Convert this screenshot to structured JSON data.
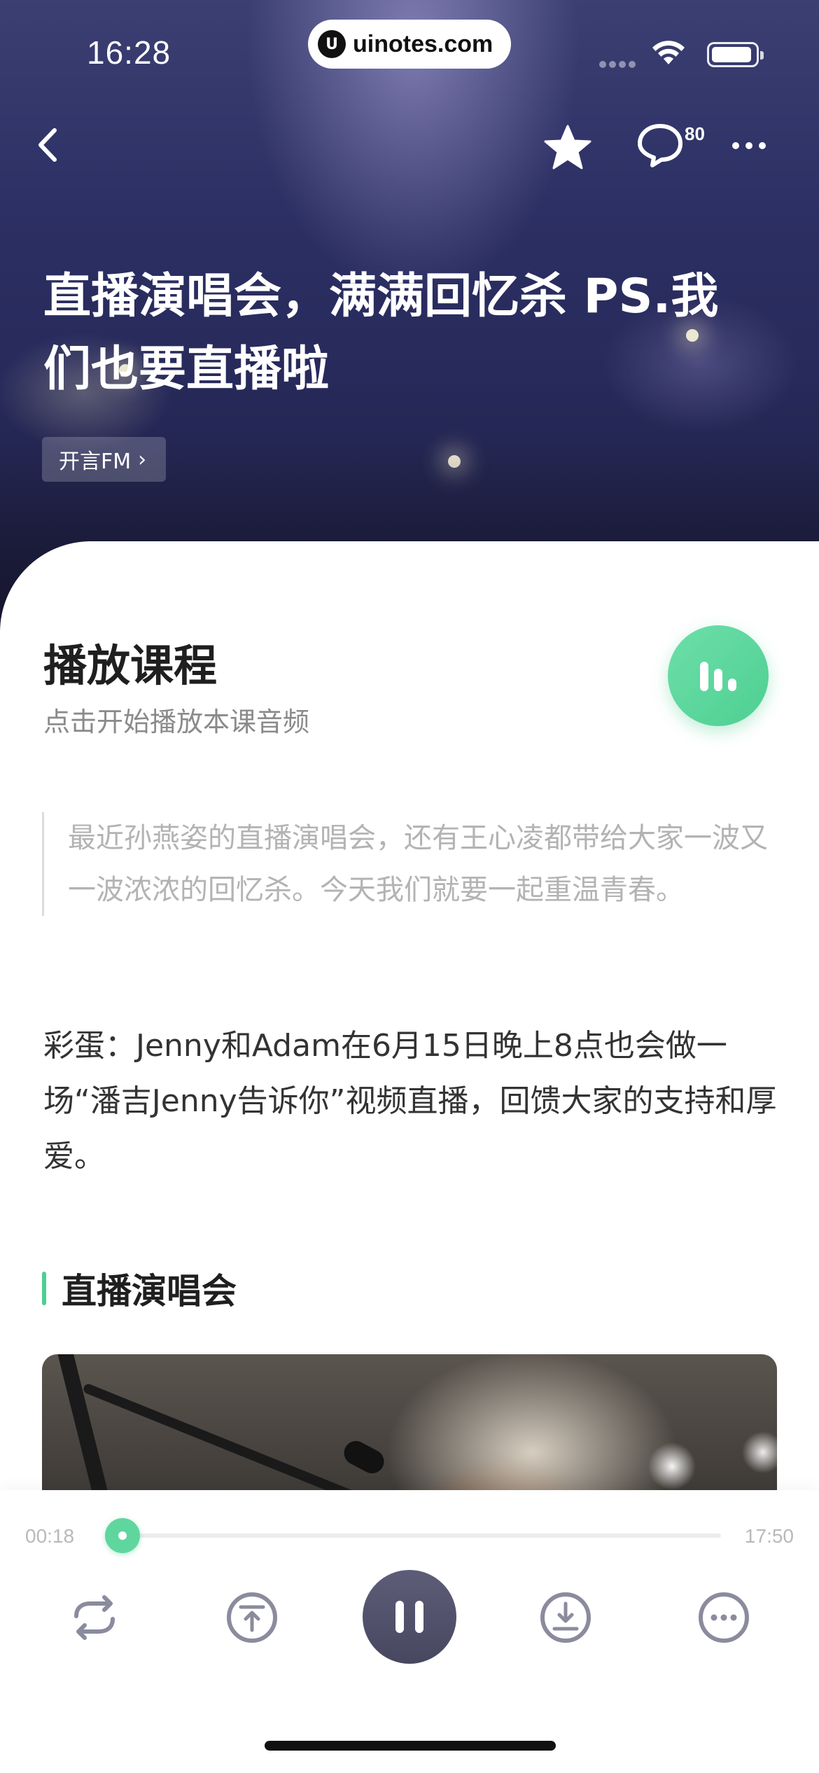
{
  "status_bar": {
    "time": "16:28",
    "url": "uinotes.com",
    "url_logo_letter": "U"
  },
  "nav": {
    "comment_count": "80"
  },
  "hero": {
    "title": "直播演唱会，满满回忆杀 PS.我们也要直播啦",
    "tag_label": "开言FM",
    "tag_chevron": "›"
  },
  "course": {
    "heading": "播放课程",
    "subheading": "点击开始播放本课音频"
  },
  "quote_text": "最近孙燕姿的直播演唱会，还有王心凌都带给大家一波又一波浓浓的回忆杀。今天我们就要一起重温青春。",
  "body_text": "彩蛋：Jenny和Adam在6月15日晚上8点也会做一场“潘吉Jenny告诉你”视频直播，回馈大家的支持和厚爱。",
  "section_title": "直播演唱会",
  "player": {
    "current_time": "00:18",
    "total_time": "17:50",
    "progress_fraction": 0.017,
    "controls": [
      "repeat-icon",
      "previous-icon",
      "pause-icon",
      "download-icon",
      "more-options-icon"
    ]
  },
  "colors": {
    "accent": "#4ecf92",
    "pause_button": "#4f4f6a",
    "hero_bg": "#2c2f63"
  }
}
